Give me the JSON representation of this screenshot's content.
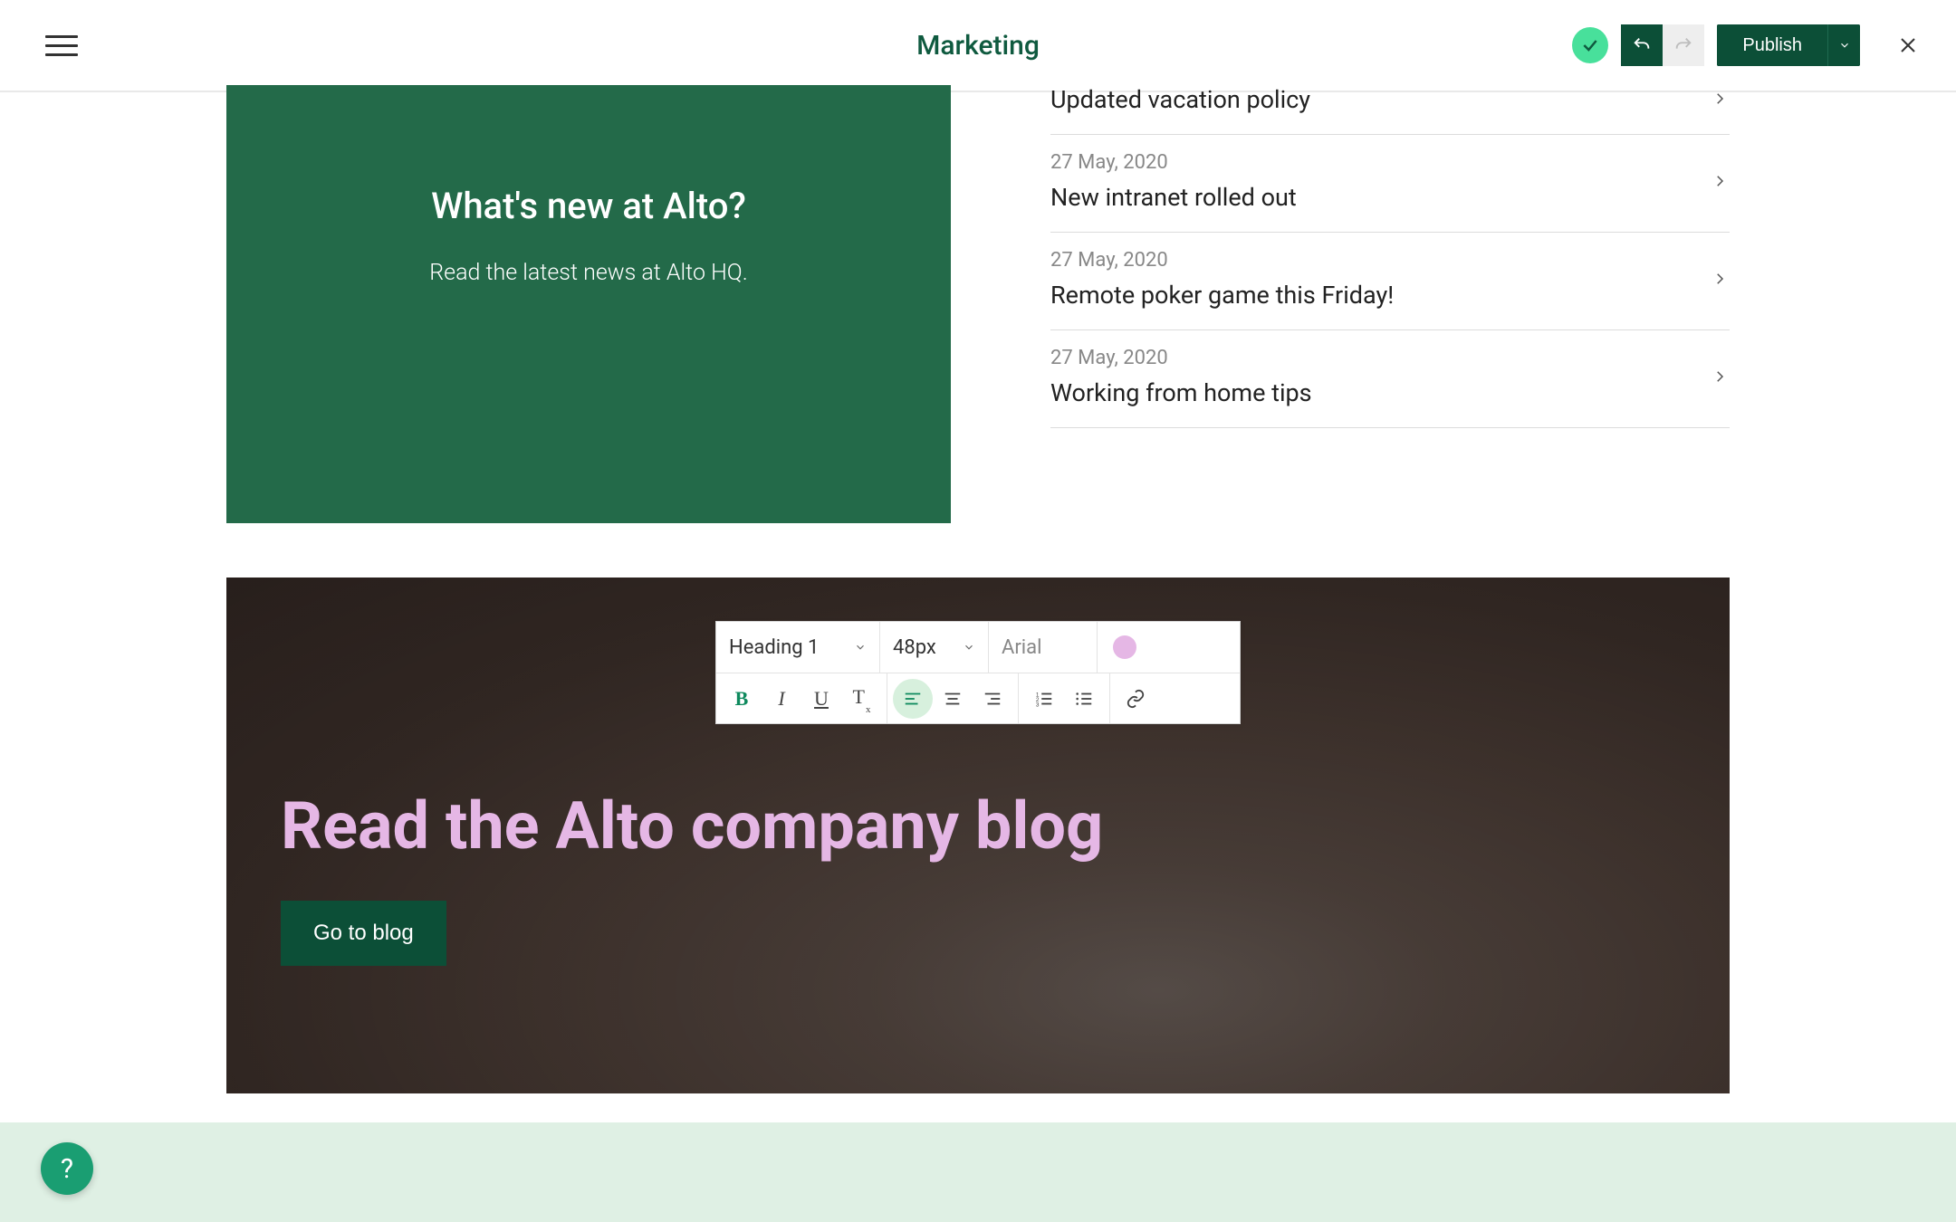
{
  "header": {
    "title": "Marketing",
    "publish_label": "Publish"
  },
  "whatsNew": {
    "heading": "What's new at Alto?",
    "subheading": "Read the latest news at Alto HQ."
  },
  "news": [
    {
      "date": "",
      "headline": "Updated vacation policy"
    },
    {
      "date": "27 May, 2020",
      "headline": "New intranet rolled out"
    },
    {
      "date": "27 May, 2020",
      "headline": "Remote poker game this Friday!"
    },
    {
      "date": "27 May, 2020",
      "headline": "Working from home tips"
    }
  ],
  "hero": {
    "headline": "Read the Alto company blog",
    "cta_label": "Go to blog"
  },
  "toolbar": {
    "style": "Heading 1",
    "size": "48px",
    "font": "Arial",
    "color": "#e5b7e5"
  },
  "help_label": "?"
}
